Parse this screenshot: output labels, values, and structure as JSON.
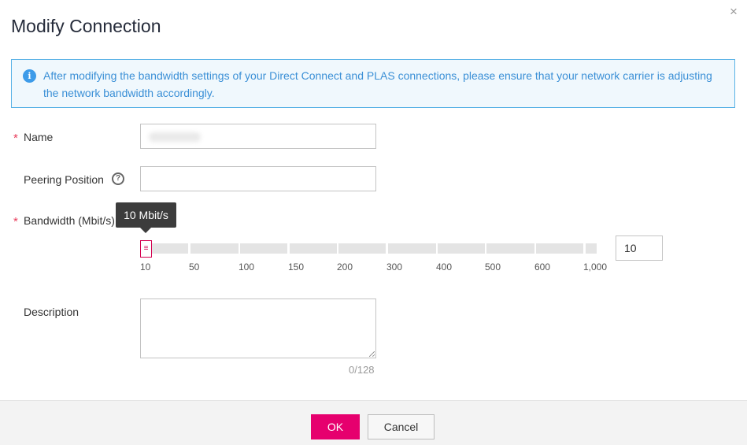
{
  "dialog": {
    "title": "Modify Connection",
    "close_icon": "close-icon",
    "close_glyph": "×"
  },
  "notice": {
    "icon": "info-icon",
    "icon_glyph": "i",
    "text": "After modifying the bandwidth settings of your Direct Connect and PLAS connections, please ensure that your network carrier is adjusting the network bandwidth accordingly."
  },
  "form": {
    "required_mark": "*",
    "name": {
      "label": "Name",
      "value": ""
    },
    "peering_position": {
      "label": "Peering Position",
      "help_icon": "help-icon",
      "help_glyph": "?",
      "value": ""
    },
    "bandwidth": {
      "label": "Bandwidth (Mbit/s)",
      "tooltip": "10 Mbit/s",
      "value": "10",
      "slider_value": 10,
      "handle_glyph": "≡",
      "ticks": [
        "10",
        "50",
        "100",
        "150",
        "200",
        "300",
        "400",
        "500",
        "600",
        "1,000"
      ]
    },
    "description": {
      "label": "Description",
      "value": "",
      "counter": "0/128"
    }
  },
  "footer": {
    "ok_label": "OK",
    "cancel_label": "Cancel"
  },
  "colors": {
    "accent": "#e6006e",
    "info": "#3a8fd6",
    "required": "#e83b5a"
  }
}
